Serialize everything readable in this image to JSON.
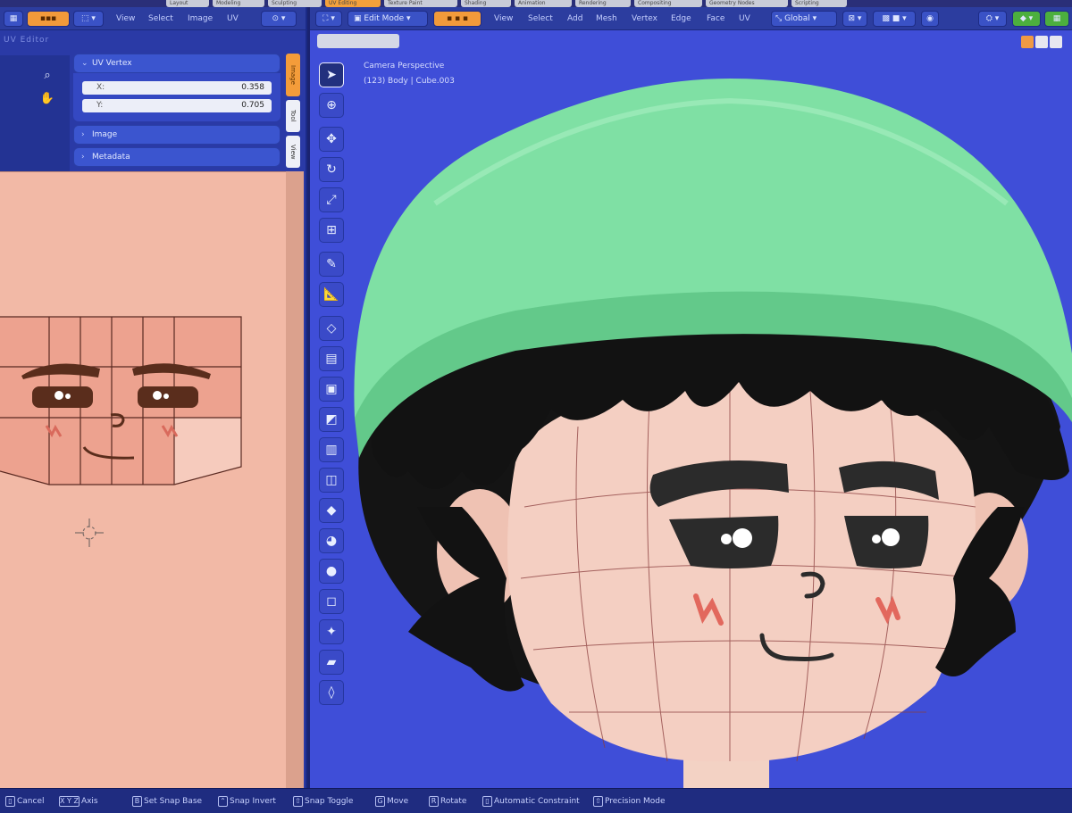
{
  "topbar": {
    "workspaces": [
      "Layout",
      "Modeling",
      "Sculpting",
      "UV Editing",
      "Texture Paint",
      "Shading",
      "Animation",
      "Rendering",
      "Compositing",
      "Geometry Nodes",
      "Scripting"
    ],
    "active_workspace": "UV Editing"
  },
  "uv_editor": {
    "menus": [
      "View",
      "Select",
      "Image",
      "UV"
    ],
    "title": "UV Editor",
    "panel_uv_vertex": {
      "header": "UV Vertex",
      "x_label": "X:",
      "x_value": "0.358",
      "y_label": "Y:",
      "y_value": "0.705"
    },
    "panel_image": "Image",
    "panel_metadata": "Metadata",
    "side_tabs": [
      "Image",
      "Tool",
      "View"
    ]
  },
  "viewport": {
    "mode": "Edit Mode",
    "menus": [
      "View",
      "Select",
      "Add",
      "Mesh",
      "Vertex",
      "Edge",
      "Face",
      "UV"
    ],
    "transform_orientation": "Global",
    "info_line1": "Camera Perspective",
    "info_line2": "(123) Body | Cube.003"
  },
  "statusbar": {
    "items": [
      {
        "key": "",
        "label": "Cancel"
      },
      {
        "key": "X Y Z",
        "label": "Axis"
      },
      {
        "key": "B",
        "label": "Set Snap Base"
      },
      {
        "key": "",
        "label": "Snap Invert"
      },
      {
        "key": "",
        "label": "Snap Toggle"
      },
      {
        "key": "G",
        "label": "Move"
      },
      {
        "key": "R",
        "label": "Rotate"
      },
      {
        "key": "",
        "label": "Automatic Constraint"
      },
      {
        "key": "",
        "label": "Precision Mode"
      }
    ]
  },
  "colors": {
    "header_bg": "#2c3d9f",
    "viewport_bg": "#3f4ed8",
    "uv_canvas_bg": "#f2b9a6",
    "accent": "#f49c3a",
    "hat_green": "#79de9e",
    "skin": "#f4cfc2"
  }
}
